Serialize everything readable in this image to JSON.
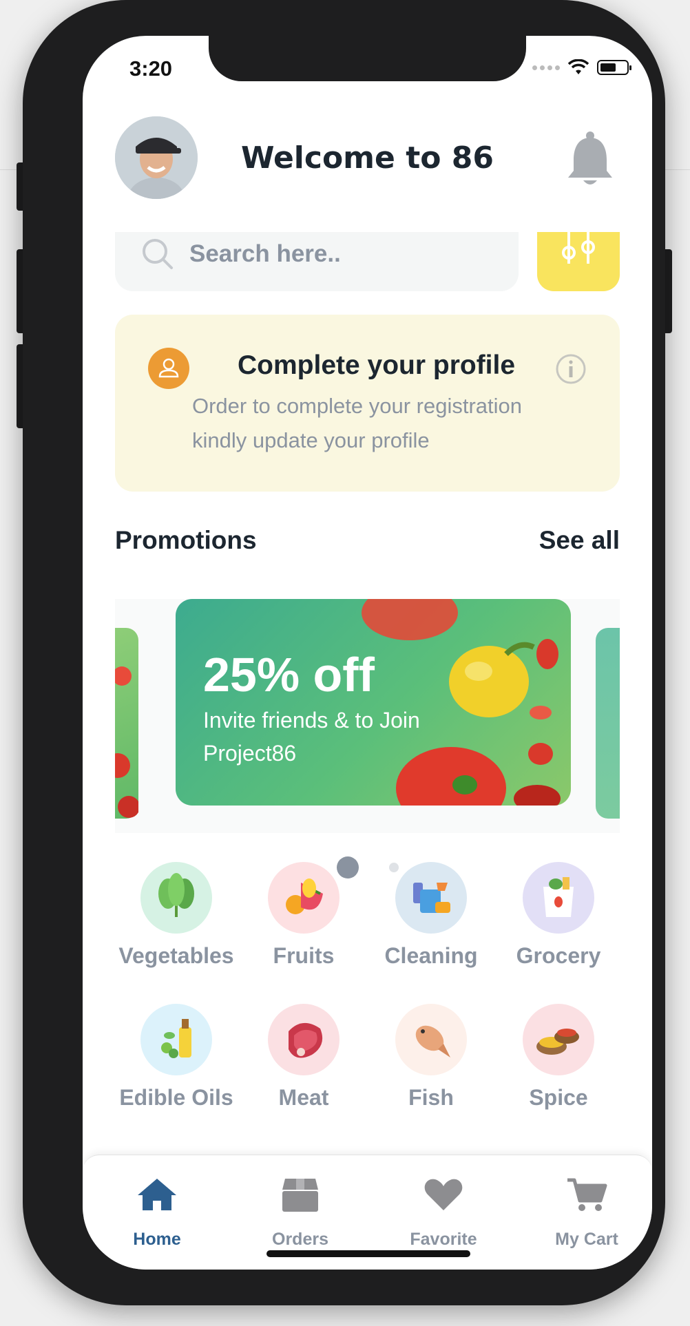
{
  "status_bar": {
    "time": "3:20"
  },
  "header": {
    "title": "Welcome to 86"
  },
  "search": {
    "placeholder": "Search here.."
  },
  "profile_card": {
    "title": "Complete your profile",
    "description": "Order to complete your registration kindly update your profile"
  },
  "promotions": {
    "title": "Promotions",
    "see_all": "See all",
    "slide": {
      "headline": "25% off",
      "subtitle": "Invite friends & to Join Project86"
    },
    "active_page": 2,
    "page_count": 4
  },
  "categories": [
    {
      "label": "Vegetables",
      "bg": "#d6f2e4"
    },
    {
      "label": "Fruits",
      "bg": "#fde0e2"
    },
    {
      "label": "Cleaning",
      "bg": "#dbe8f2"
    },
    {
      "label": "Grocery",
      "bg": "#e2dff6"
    },
    {
      "label": "Edible Oils",
      "bg": "#dcf2fb"
    },
    {
      "label": "Meat",
      "bg": "#fbe0e3"
    },
    {
      "label": "Fish",
      "bg": "#fdf0ea"
    },
    {
      "label": "Spice",
      "bg": "#fbe0e3"
    }
  ],
  "tabs": [
    {
      "label": "Home",
      "icon": "home-icon",
      "active": true
    },
    {
      "label": "Orders",
      "icon": "box-icon",
      "active": false
    },
    {
      "label": "Favorite",
      "icon": "heart-icon",
      "active": false
    },
    {
      "label": "My Cart",
      "icon": "cart-icon",
      "active": false
    }
  ],
  "colors": {
    "accent": "#2d5f8f",
    "filter_button": "#f9e45e",
    "profile_card_bg": "#faf7e0",
    "profile_icon": "#ec9b34",
    "muted_text": "#8a93a0"
  }
}
